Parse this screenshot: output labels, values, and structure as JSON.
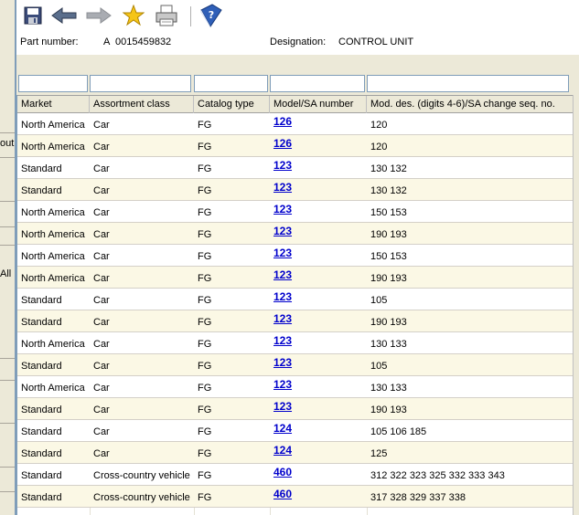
{
  "left_window": {
    "fragments": [
      "out",
      "All"
    ]
  },
  "toolbar": {
    "buttons": [
      {
        "name": "save-icon"
      },
      {
        "name": "back-arrow-icon"
      },
      {
        "name": "forward-arrow-icon"
      },
      {
        "name": "star-icon"
      },
      {
        "name": "printer-icon"
      },
      {
        "name": "help-book-icon"
      }
    ]
  },
  "info": {
    "part_number_label": "Part number:",
    "part_number_prefix": "A",
    "part_number_value": "0015459832",
    "designation_label": "Designation:",
    "designation_value": "CONTROL UNIT"
  },
  "columns": [
    "Market",
    "Assortment class",
    "Catalog type",
    "Model/SA number",
    "Mod. des. (digits 4-6)/SA change seq. no."
  ],
  "rows": [
    {
      "market": "North America",
      "assortment": "Car",
      "catalog": "FG",
      "model": "126",
      "moddes": "120"
    },
    {
      "market": "North America",
      "assortment": "Car",
      "catalog": "FG",
      "model": "126",
      "moddes": "120"
    },
    {
      "market": "Standard",
      "assortment": "Car",
      "catalog": "FG",
      "model": "123",
      "moddes": "130 132"
    },
    {
      "market": "Standard",
      "assortment": "Car",
      "catalog": "FG",
      "model": "123",
      "moddes": "130 132"
    },
    {
      "market": "North America",
      "assortment": "Car",
      "catalog": "FG",
      "model": "123",
      "moddes": "150 153"
    },
    {
      "market": "North America",
      "assortment": "Car",
      "catalog": "FG",
      "model": "123",
      "moddes": "190 193"
    },
    {
      "market": "North America",
      "assortment": "Car",
      "catalog": "FG",
      "model": "123",
      "moddes": "150 153"
    },
    {
      "market": "North America",
      "assortment": "Car",
      "catalog": "FG",
      "model": "123",
      "moddes": "190 193"
    },
    {
      "market": "Standard",
      "assortment": "Car",
      "catalog": "FG",
      "model": "123",
      "moddes": "105"
    },
    {
      "market": "Standard",
      "assortment": "Car",
      "catalog": "FG",
      "model": "123",
      "moddes": "190 193"
    },
    {
      "market": "North America",
      "assortment": "Car",
      "catalog": "FG",
      "model": "123",
      "moddes": "130 133"
    },
    {
      "market": "Standard",
      "assortment": "Car",
      "catalog": "FG",
      "model": "123",
      "moddes": "105"
    },
    {
      "market": "North America",
      "assortment": "Car",
      "catalog": "FG",
      "model": "123",
      "moddes": "130 133"
    },
    {
      "market": "Standard",
      "assortment": "Car",
      "catalog": "FG",
      "model": "123",
      "moddes": "190 193"
    },
    {
      "market": "Standard",
      "assortment": "Car",
      "catalog": "FG",
      "model": "124",
      "moddes": "105 106 185"
    },
    {
      "market": "Standard",
      "assortment": "Car",
      "catalog": "FG",
      "model": "124",
      "moddes": "125"
    },
    {
      "market": "Standard",
      "assortment": "Cross-country vehicle",
      "catalog": "FG",
      "model": "460",
      "moddes": "312 322 323 325 332 333 343"
    },
    {
      "market": "Standard",
      "assortment": "Cross-country vehicle",
      "catalog": "FG",
      "model": "460",
      "moddes": "317 328 329 337 338"
    }
  ],
  "colors": {
    "link": "#0000cc",
    "row_alt": "#fbf8e5",
    "chrome": "#ece9d8",
    "border": "#7f9db9"
  }
}
